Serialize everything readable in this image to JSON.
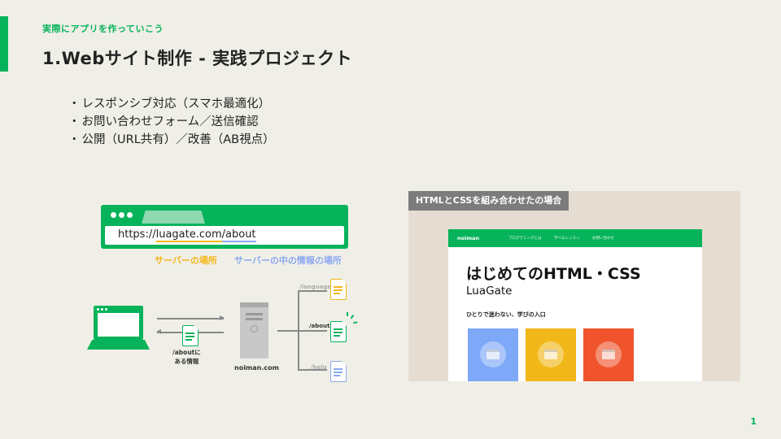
{
  "header": {
    "kicker": "実際にアプリを作っていこう",
    "title": "1.Webサイト制作 - 実践プロジェクト"
  },
  "bullets": [
    "レスポンシブ対応（スマホ最適化）",
    "お問い合わせフォーム／送信確認",
    "公開（URL共有）／改善（AB視点）"
  ],
  "diagram": {
    "url_scheme": "https://",
    "url_host": "luagate.com",
    "url_path": "/about",
    "label_host": "サーバーの場所",
    "label_path": "サーバーの中の情報の場所",
    "doc_caption_line1": "/aboutに",
    "doc_caption_line2": "ある情報",
    "server_label": "noiman.com",
    "paths": [
      "/languages",
      "/about",
      "/help"
    ]
  },
  "panel": {
    "label": "HTMLとCSSを組み合わせたの場合",
    "site": {
      "logo": "noiman",
      "nav_links": [
        "プログラミングとは",
        "学べるレッスン",
        "お問い合わせ"
      ],
      "heading": "はじめてのHTML・CSS",
      "subheading": "LuaGate",
      "tagline": "ひとりで迷わない、学びの入口",
      "cards": [
        {
          "color": "#7ea8f8",
          "icon": "window-icon"
        },
        {
          "color": "#f2b718",
          "icon": "window-icon"
        },
        {
          "color": "#f0542c",
          "icon": "window-icon"
        }
      ]
    }
  },
  "footer": {
    "page_number": "1"
  },
  "colors": {
    "brand": "#06b35a",
    "host_highlight": "#f2b718",
    "path_highlight": "#8aa9f0",
    "background": "#f0efe7"
  }
}
